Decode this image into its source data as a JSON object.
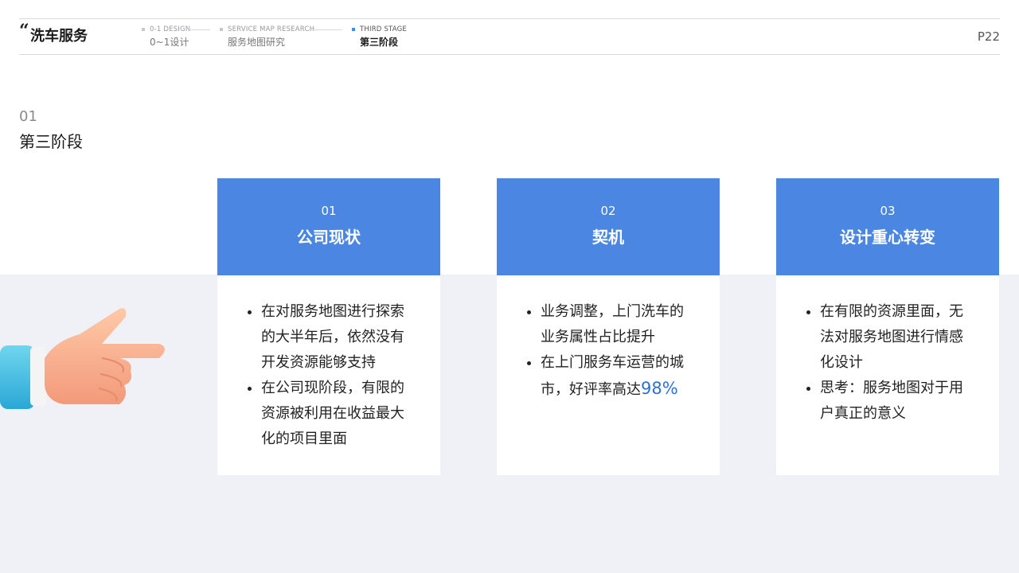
{
  "header": {
    "quote": "“",
    "brand": "洗车服务",
    "stages": [
      {
        "en": "0-1 DESIGN",
        "zh": "0~1设计"
      },
      {
        "en": "SERVICE MAP RESEARCH",
        "zh": "服务地图研究"
      },
      {
        "en": "THIRD STAGE",
        "zh": "第三阶段"
      }
    ],
    "page": "P22"
  },
  "section": {
    "num": "01",
    "title": "第三阶段"
  },
  "cards": [
    {
      "num": "01",
      "title": "公司现状",
      "bullets": [
        "在对服务地图进行探索的大半年后，依然没有开发资源能够支持",
        "在公司现阶段，有限的资源被利用在收益最大化的项目里面"
      ]
    },
    {
      "num": "02",
      "title": "契机",
      "bullets": [
        "业务调整，上门洗车的业务属性占比提升",
        "在上门服务车运营的城市，好评率高达"
      ],
      "highlight": "98%"
    },
    {
      "num": "03",
      "title": "设计重心转变",
      "bullets": [
        "在有限的资源里面，无法对服务地图进行情感化设计",
        "思考：服务地图对于用户真正的意义"
      ]
    }
  ],
  "colors": {
    "accent": "#4a86e2",
    "highlight": "#2f6fd8",
    "band": "#f0f1f6"
  }
}
